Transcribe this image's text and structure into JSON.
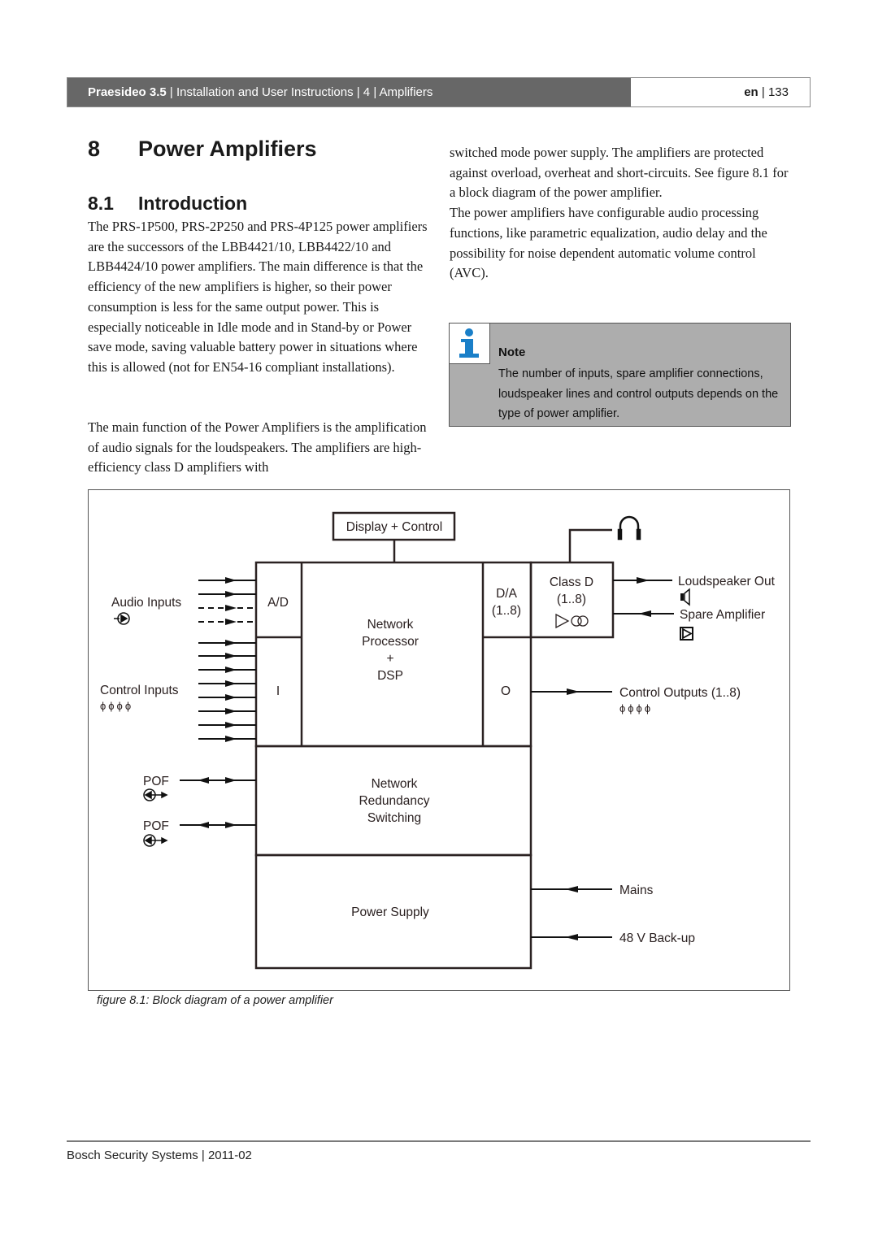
{
  "header": {
    "product": "Praesideo 3.5",
    "breadcrumb": " | Installation and User Instructions | 4 | Amplifiers",
    "lang": "en",
    "page_sep": " | ",
    "page_number": "133"
  },
  "chapter": {
    "number": "8",
    "title": "Power Amplifiers"
  },
  "section": {
    "number": "8.1",
    "title": "Introduction"
  },
  "paragraphs": {
    "p1": "The PRS-1P500, PRS-2P250 and PRS-4P125 power amplifiers are the successors of the LBB4421/10, LBB4422/10 and LBB4424/10 power amplifiers. The main difference is that the efficiency of the new amplifiers is higher, so their power consumption is less for the same output power. This is especially noticeable in Idle mode and in Stand-by or Power save mode, saving valuable battery power in situations where this is allowed (not for EN54-16 compliant installations).",
    "p2": "The main function of the Power Amplifiers is the amplification of audio signals for the loudspeakers. The amplifiers are high-efficiency class D amplifiers with",
    "p3": "switched mode power supply. The amplifiers are protected against overload, overheat and short-circuits. See figure 8.1 for a block diagram of the power amplifier.",
    "p4": "The power amplifiers have configurable audio processing functions, like parametric equalization, audio delay and the possibility for noise dependent automatic volume control (AVC)."
  },
  "note": {
    "icon": "info-icon",
    "icon_color": "#1a7fc8",
    "title": "Note",
    "body": "The number of inputs, spare amplifier connections, loudspeaker lines and control outputs depends on the type of power amplifier."
  },
  "diagram": {
    "blocks": {
      "display_control": "Display + Control",
      "ad": "A/D",
      "i": "I",
      "processor": [
        "Network",
        "Processor",
        "+",
        "DSP"
      ],
      "da": [
        "D/A",
        "(1..8)"
      ],
      "o": "O",
      "class_d": [
        "Class D",
        "(1..8)"
      ],
      "redundancy": [
        "Network",
        "Redundancy",
        "Switching"
      ],
      "power_supply": "Power Supply"
    },
    "labels": {
      "audio_inputs": "Audio Inputs",
      "control_inputs": "Control Inputs",
      "control_inputs_symbol": "ϕϕϕϕ",
      "pof1": "POF",
      "pof2": "POF",
      "loudspeaker_out": "Loudspeaker Out",
      "spare_amplifier": "Spare Amplifier",
      "control_outputs": "Control Outputs (1..8)",
      "control_outputs_symbol": "ϕϕϕϕ",
      "mains": "Mains",
      "backup": "48 V Back-up"
    },
    "icons": [
      "headphones-icon",
      "loudspeaker-icon",
      "spare-amplifier-icon",
      "audio-input-icon",
      "pof-connector-icon",
      "amplifier-symbol-icon"
    ]
  },
  "caption": "figure 8.1: Block diagram of a power amplifier",
  "footer": {
    "text": "Bosch Security Systems | 2011-02"
  }
}
